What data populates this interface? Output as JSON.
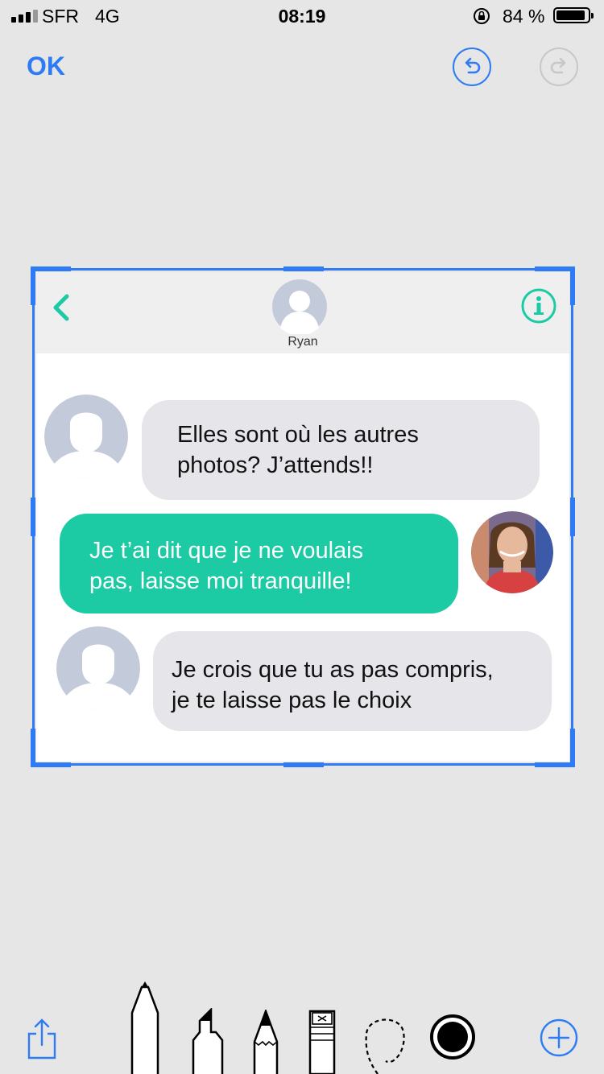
{
  "status_bar": {
    "carrier": "SFR",
    "network": "4G",
    "time": "08:19",
    "battery_percent": "84 %",
    "battery_level": 0.84
  },
  "toolbar": {
    "ok_label": "OK",
    "accent_color": "#2d7cf6",
    "undo_icon": "undo-icon",
    "redo_icon": "redo-icon"
  },
  "embedded_chat": {
    "contact_name": "Ryan",
    "messages": [
      {
        "direction": "incoming",
        "lines": [
          "Elles sont où les autres",
          "photos? J’attends!!"
        ]
      },
      {
        "direction": "outgoing",
        "lines": [
          "Je t’ai dit que je ne voulais",
          "pas, laisse moi tranquille!"
        ]
      },
      {
        "direction": "incoming",
        "lines": [
          "Je crois que tu as pas compris,",
          "je te laisse pas le choix"
        ]
      }
    ],
    "outgoing_color": "#1ccaa4",
    "incoming_color": "#e5e5ea"
  },
  "bottom_tools": {
    "items": [
      "share-icon",
      "pen-icon",
      "marker-icon",
      "pencil-icon",
      "eraser-icon",
      "lasso-icon",
      "color-picker",
      "add-icon"
    ],
    "selected_color": "#000000"
  }
}
